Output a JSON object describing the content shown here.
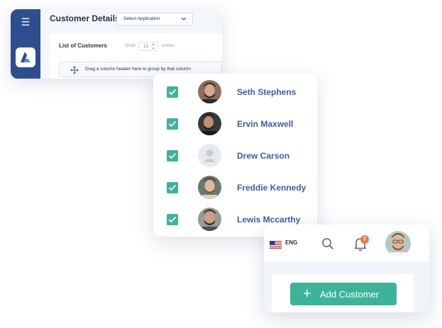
{
  "customer_details": {
    "title": "Customer Details",
    "app_select": {
      "value": "Select Application",
      "icon": "chevron-down-icon"
    },
    "list_title": "List of Customers",
    "show_label": "Show",
    "entries_value": "12",
    "entries_label": "entries",
    "drag_hint": "Drag a column header here to group by that column",
    "sidebar": {
      "menu_icon": "hamburger-menu-icon",
      "logo_icon": "app-logo-icon",
      "color": "#2f4e8f"
    }
  },
  "customers": [
    {
      "name": "Seth Stephens",
      "checked": true,
      "avatar": "photo"
    },
    {
      "name": "Ervin Maxwell",
      "checked": true,
      "avatar": "photo"
    },
    {
      "name": "Drew Carson",
      "checked": true,
      "avatar": "placeholder"
    },
    {
      "name": "Freddie Kennedy",
      "checked": true,
      "avatar": "photo"
    },
    {
      "name": "Lewis Mccarthy",
      "checked": true,
      "avatar": "photo"
    }
  ],
  "topbar": {
    "language": "ENG",
    "flag_icon": "us-flag-icon",
    "search_icon": "search-icon",
    "notifications_icon": "bell-icon",
    "notification_count": "2",
    "user_avatar": "user-avatar"
  },
  "actions": {
    "add_customer_label": "Add Customer",
    "add_icon": "plus-icon"
  },
  "colors": {
    "accent": "#3db39a",
    "primary": "#2f4e8f",
    "name_text": "#3f5aa8",
    "badge": "#f0763f"
  }
}
